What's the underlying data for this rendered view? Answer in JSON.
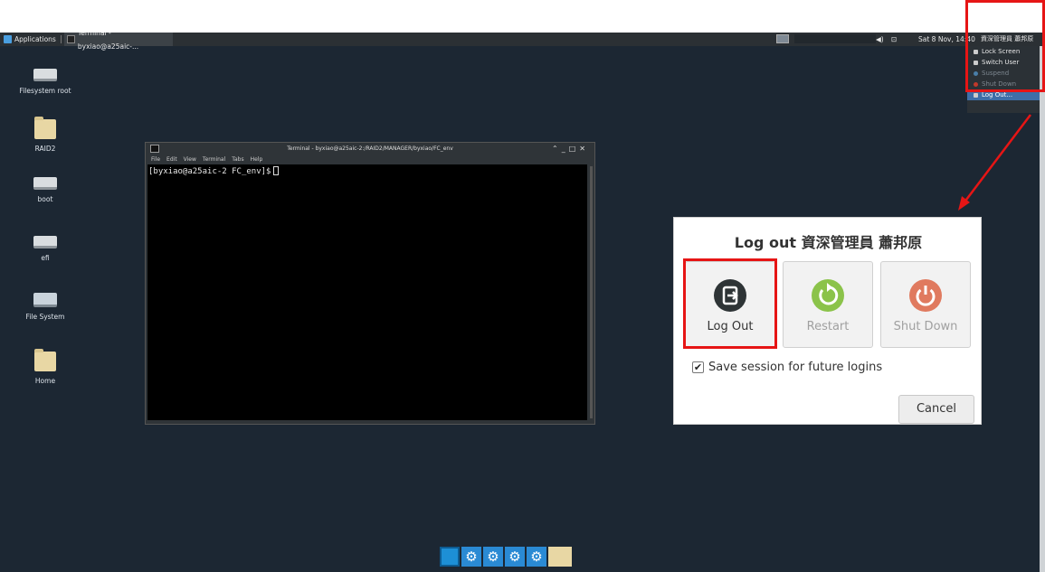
{
  "panel": {
    "applications_label": "Applications",
    "task_label": "Terminal - byxiao@a25aic-...",
    "clock": "Sat  8 Nov, 14:40",
    "user": "資深管理員 蕭邦原"
  },
  "desktop_icons": [
    {
      "label": "Filesystem root"
    },
    {
      "label": "RAID2"
    },
    {
      "label": "boot"
    },
    {
      "label": "efi"
    },
    {
      "label": "File System"
    },
    {
      "label": "Home"
    }
  ],
  "terminal": {
    "title": "Terminal - byxiao@a25aic-2:/RAID2/MANAGER/byxiao/FC_env",
    "menu": [
      "File",
      "Edit",
      "View",
      "Terminal",
      "Tabs",
      "Help"
    ],
    "prompt": "[byxiao@a25aic-2 FC_env]$"
  },
  "user_menu": {
    "items": [
      {
        "label": "Lock Screen",
        "icon": "lock-icon",
        "state": "normal"
      },
      {
        "label": "Switch User",
        "icon": "switch-user-icon",
        "state": "normal"
      },
      {
        "label": "Suspend",
        "icon": "suspend-icon",
        "state": "disabled"
      },
      {
        "label": "Shut Down",
        "icon": "power-icon",
        "state": "disabled"
      },
      {
        "label": "Log Out...",
        "icon": "logout-icon",
        "state": "selected"
      }
    ]
  },
  "dialog": {
    "title": "Log out 資深管理員 蕭邦原",
    "buttons": [
      {
        "label": "Log Out",
        "icon": "logout-icon",
        "color": "#2e3436",
        "enabled": true
      },
      {
        "label": "Restart",
        "icon": "restart-icon",
        "color": "#8bc34a",
        "enabled": false
      },
      {
        "label": "Shut Down",
        "icon": "power-icon",
        "color": "#e07a5f",
        "enabled": false
      }
    ],
    "save_session_label": "Save session for future logins",
    "save_session_checked": true,
    "cancel_label": "Cancel"
  },
  "colors": {
    "desktop_bg": "#1c2733",
    "highlight": "#e61515",
    "menu_selected": "#3d6ea8"
  }
}
